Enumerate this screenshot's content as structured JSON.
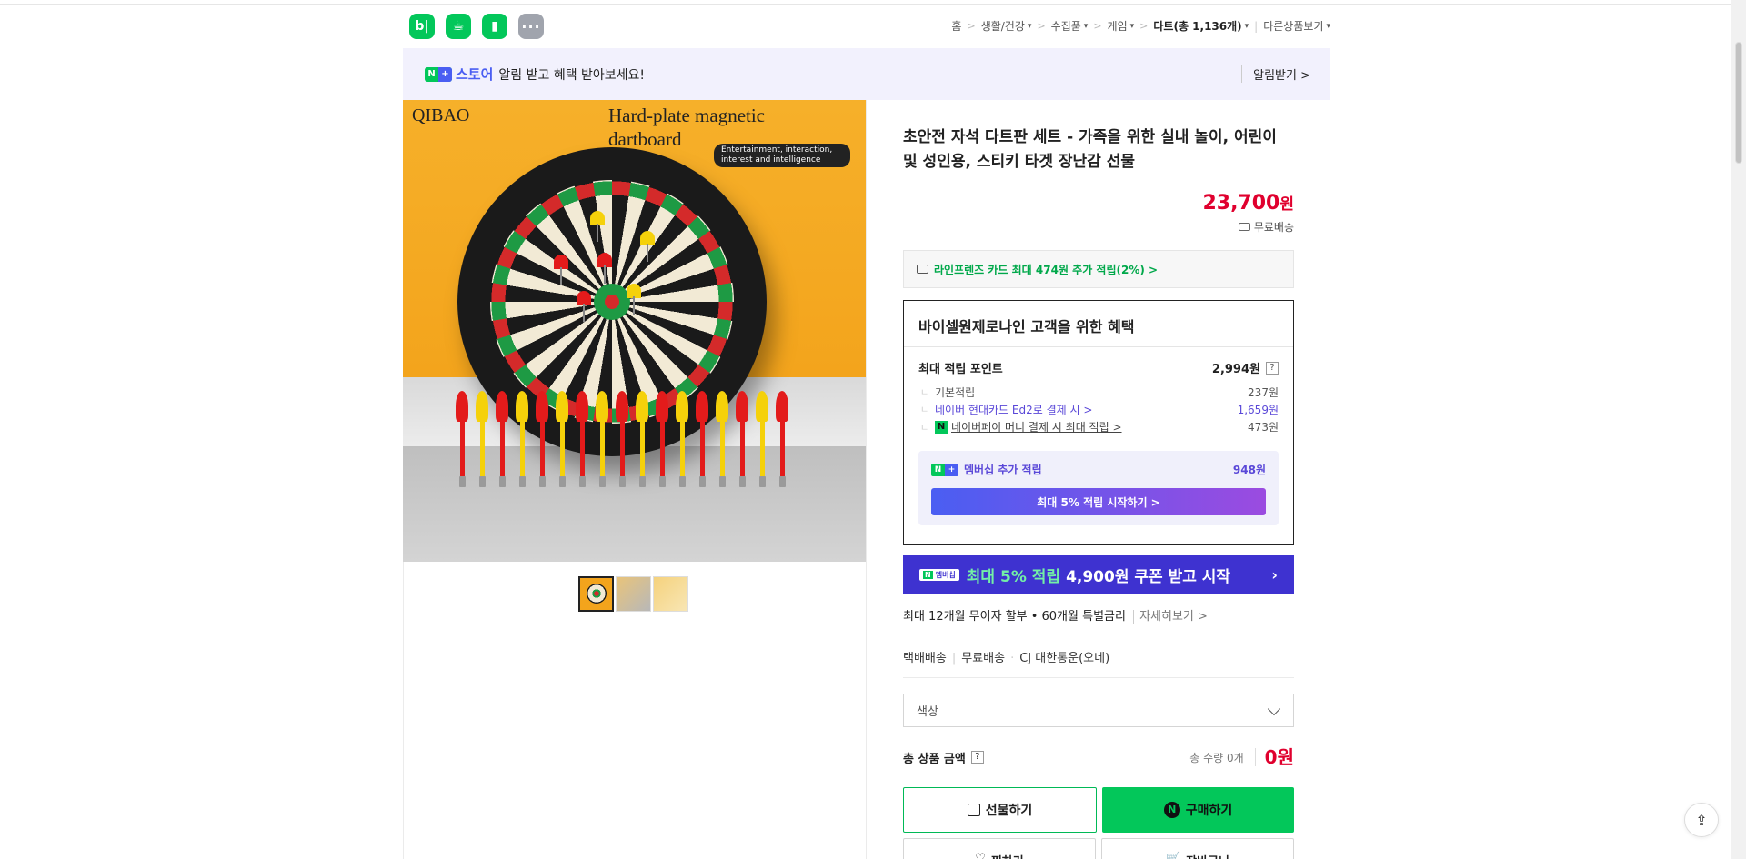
{
  "header": {
    "app_icons": [
      {
        "name": "blog-icon",
        "glyph": "b|"
      },
      {
        "name": "cafe-icon",
        "glyph": "☕"
      },
      {
        "name": "bookmark-icon",
        "glyph": "▮"
      },
      {
        "name": "more-icon",
        "glyph": "···"
      }
    ],
    "breadcrumb": [
      "홈",
      "생활/건강",
      "수집품",
      "게임",
      "다트(총 1,136개)",
      "다른상품보기"
    ]
  },
  "notify": {
    "store_badge": [
      "N",
      "+"
    ],
    "store_name": "스토어",
    "message": "알림 받고 혜택 받아보세요!",
    "alarm_label": "알림받기 >"
  },
  "product_image": {
    "brand": "QIBAO",
    "headline_line1": "Hard-plate magnetic",
    "headline_line2": "dartboard",
    "tagline": "Entertainment, interaction, interest and intelligence"
  },
  "product": {
    "title": "초안전 자석 다트판 세트 - 가족을 위한 실내 놀이, 어린이 및 성인용, 스티키 타겟 장난감 선물",
    "price": "23,700",
    "currency": "원",
    "shipping": "무료배송",
    "card_offer": "라인프렌즈 카드 최대 474원 추가 적립(2%) >"
  },
  "benefit": {
    "heading": "바이셀원제로나인 고객을 위한 혜택",
    "max_points_label": "최대 적립 포인트",
    "max_points_value": "2,994원",
    "help": "?",
    "rows": [
      {
        "label": "기본적립",
        "value": "237원"
      },
      {
        "label": "네이버 현대카드 Ed2로 결제 시 >",
        "value": "1,659원"
      },
      {
        "label": "네이버페이 머니 결제 시 최대 적립 >",
        "value": "473원"
      }
    ],
    "membership_label": "멤버십 추가 적립",
    "membership_value": "948원",
    "membership_button": "최대 5% 적립 시작하기 >"
  },
  "promo": {
    "badge_n": "N",
    "badge_text": "멤버십",
    "highlight": "최대 5% 적립",
    "text": "4,900원 쿠폰 받고 시작",
    "arrow": "›"
  },
  "installment": {
    "text": "최대 12개월 무이자 할부 • 60개월 특별금리",
    "more": "자세히보기 >"
  },
  "delivery": {
    "method": "택배배송",
    "fee": "무료배송",
    "carrier": "CJ 대한통운(오네)"
  },
  "option": {
    "label": "색상"
  },
  "total": {
    "label": "총 상품 금액",
    "help": "?",
    "quantity": "총 수량 0개",
    "amount": "0원"
  },
  "buttons": {
    "gift": "선물하기",
    "buy": "구매하기",
    "wish": "찜하기",
    "cart": "장바구니"
  },
  "colors": {
    "naver_green": "#03c75a",
    "price_red": "#e0002e",
    "promo_blue": "#3e32d0",
    "member_purple": "#5a48d8"
  }
}
